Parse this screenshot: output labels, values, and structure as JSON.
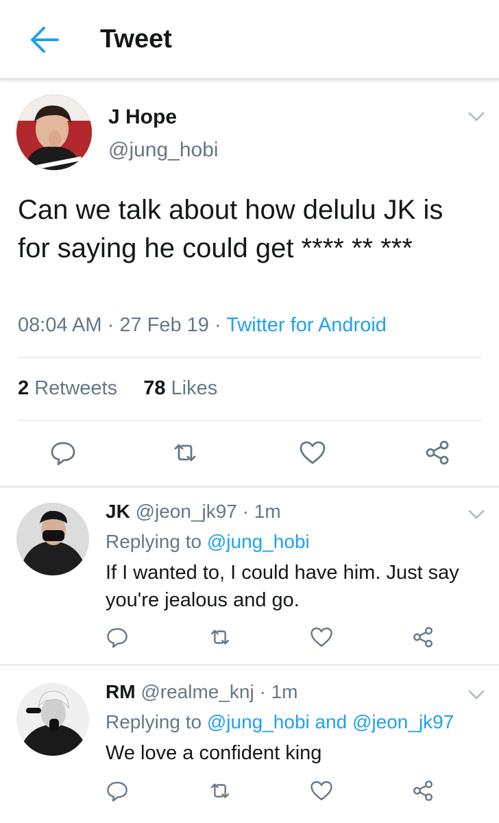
{
  "header": {
    "title": "Tweet"
  },
  "tweet": {
    "name": "J Hope",
    "handle": "@jung_hobi",
    "text": "Can we talk about how delulu JK is for saying he could get **** ** ***",
    "time": "08:04 AM",
    "date": "27 Feb 19",
    "source": "Twitter for Android",
    "retweet_count": "2",
    "retweet_label": "Retweets",
    "like_count": "78",
    "like_label": "Likes"
  },
  "replies": [
    {
      "name": "JK",
      "handle": "@jeon_jk97",
      "time": "1m",
      "replying_prefix": "Replying to",
      "replying_to": "@jung_hobi",
      "text": "If I wanted to, I could have him. Just say you're jealous and go."
    },
    {
      "name": "RM",
      "handle": "@realme_knj",
      "time": "1m",
      "replying_prefix": "Replying to",
      "replying_to": "@jung_hobi and @jeon_jk97",
      "text": "We love a confident king"
    }
  ],
  "colors": {
    "accent": "#1da1f2",
    "muted": "#657786",
    "text": "#14171a",
    "divider": "#e6ecf0"
  },
  "icons": [
    "back-arrow-icon",
    "chevron-down-icon",
    "reply-icon",
    "retweet-icon",
    "like-icon",
    "share-icon"
  ]
}
